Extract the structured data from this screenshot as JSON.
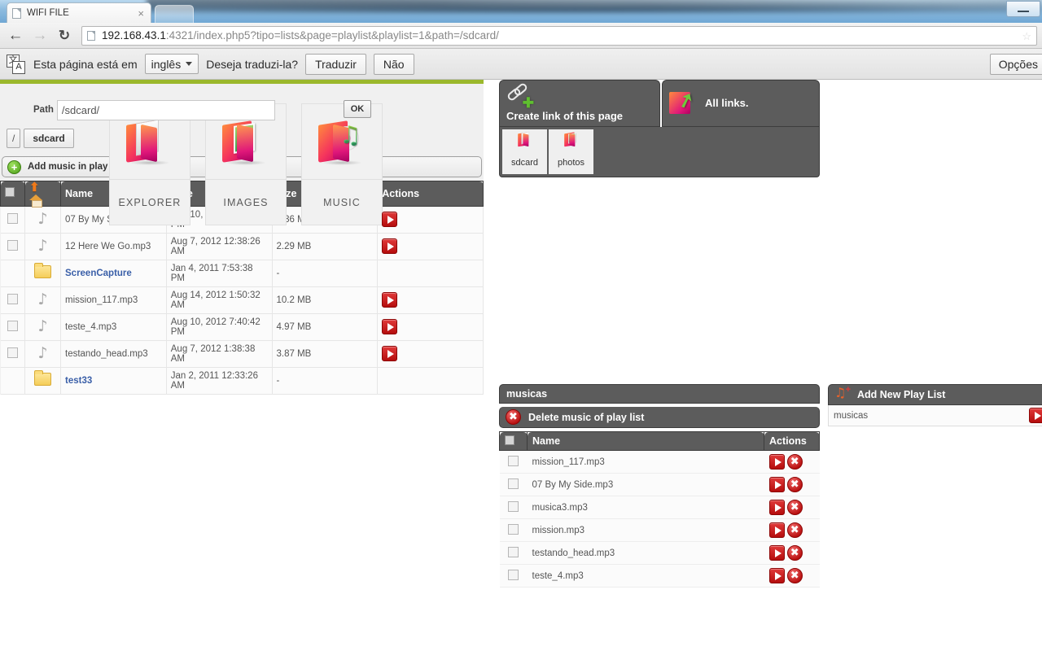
{
  "browser": {
    "tab_title": "WIFI FILE",
    "tab_close": "×",
    "back_icon": "←",
    "forward_icon": "→",
    "reload_icon": "↻",
    "url_host": "192.168.43.1",
    "url_rest": ":4321/index.php5?tipo=lists&page=playlist&playlist=1&path=/sdcard/",
    "star_icon": "☆",
    "minimize_label": ""
  },
  "translate_bar": {
    "icon_char_top": "文",
    "icon_char_bottom": "A",
    "message_prefix": "Esta página está em",
    "language": "inglês",
    "message_suffix": "Deseja traduzi-la?",
    "translate_button": "Traduzir",
    "decline_button": "Não",
    "options_button": "Opções"
  },
  "tiles": [
    {
      "label": "EXPLORER",
      "icon": "folder-explorer-icon"
    },
    {
      "label": "IMAGES",
      "icon": "folder-images-icon"
    },
    {
      "label": "MUSIC",
      "icon": "folder-music-icon"
    }
  ],
  "links_panel": {
    "create_link_label": "Create link of this page",
    "all_links_label": "All links.",
    "shortcuts": [
      {
        "label": "sdcard",
        "icon": "folder-icon"
      },
      {
        "label": "photos",
        "icon": "folder-images-icon"
      }
    ]
  },
  "file_browser": {
    "path_label": "Path",
    "path_value": "/sdcard/",
    "ok_button": "OK",
    "breadcrumbs": [
      "/",
      "sdcard"
    ],
    "add_music_label": "Add music in play list",
    "columns": {
      "name": "Name",
      "date": "Date",
      "size": "Size",
      "actions": "Actions"
    },
    "rows": [
      {
        "type": "file",
        "icon": "music-note-icon",
        "name": "07 By My Side.mp3",
        "date": "Aug 10, 2012 6:40:22 PM",
        "size": "3.36 MB",
        "action": "play"
      },
      {
        "type": "file",
        "icon": "music-note-icon",
        "name": "12 Here We Go.mp3",
        "date": "Aug 7, 2012 12:38:26 AM",
        "size": "2.29 MB",
        "action": "play"
      },
      {
        "type": "folder",
        "icon": "folder-icon",
        "name": "ScreenCapture",
        "date": "Jan 4, 2011 7:53:38 PM",
        "size": "-",
        "action": ""
      },
      {
        "type": "file",
        "icon": "music-note-icon",
        "name": "mission_117.mp3",
        "date": "Aug 14, 2012 1:50:32 AM",
        "size": "10.2 MB",
        "action": "play"
      },
      {
        "type": "file",
        "icon": "music-note-icon",
        "name": "teste_4.mp3",
        "date": "Aug 10, 2012 7:40:42 PM",
        "size": "4.97 MB",
        "action": "play"
      },
      {
        "type": "file",
        "icon": "music-note-icon",
        "name": "testando_head.mp3",
        "date": "Aug 7, 2012 1:38:38 AM",
        "size": "3.87 MB",
        "action": "play"
      },
      {
        "type": "folder",
        "icon": "folder-icon",
        "name": "test33",
        "date": "Jan 2, 2011 12:33:26 AM",
        "size": "-",
        "action": ""
      }
    ]
  },
  "playlist": {
    "title": "musicas",
    "delete_label": "Delete music of play list",
    "columns": {
      "name": "Name",
      "actions": "Actions"
    },
    "tracks": [
      {
        "name": "mission_117.mp3"
      },
      {
        "name": "07 By My Side.mp3"
      },
      {
        "name": "musica3.mp3"
      },
      {
        "name": "mission.mp3"
      },
      {
        "name": "testando_head.mp3"
      },
      {
        "name": "teste_4.mp3"
      }
    ]
  },
  "add_playlist": {
    "title": "Add New Play List",
    "input_value": "musicas",
    "input_placeholder": ""
  },
  "colors": {
    "accent_green": "#9bb82c",
    "panel_dark": "#5c5c5c",
    "play_red": "#b50d0d",
    "link_blue": "#3a5fa8"
  }
}
